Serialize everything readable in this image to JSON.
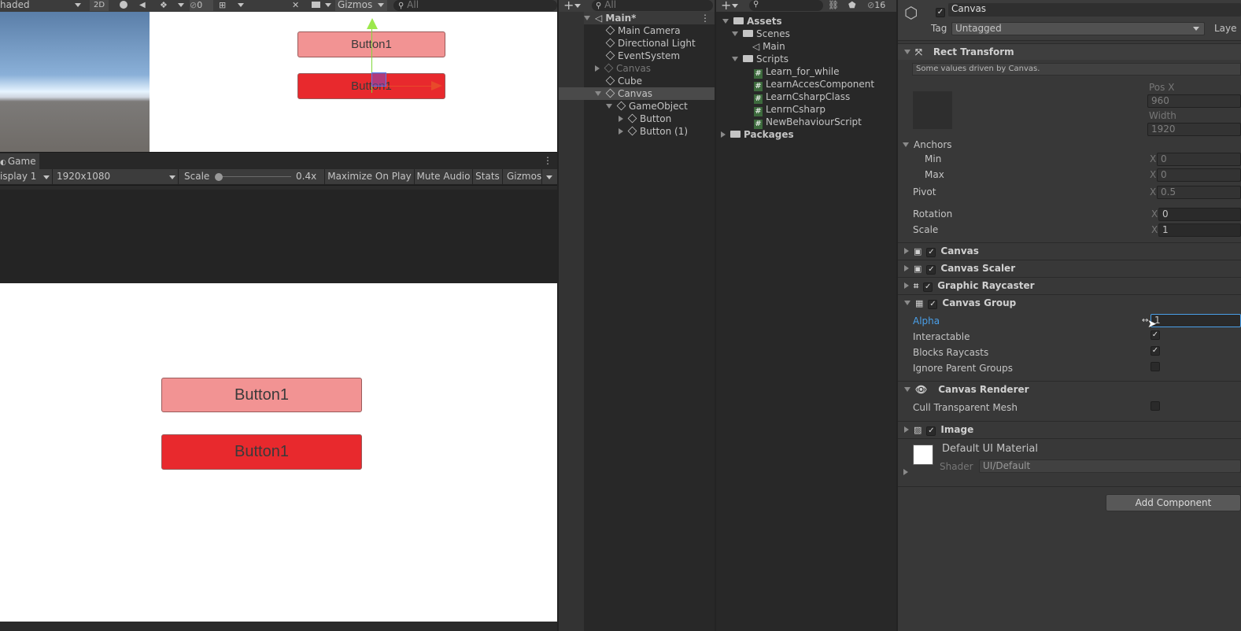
{
  "scene_toolbar": {
    "shading": "haded",
    "mode_2d": "2D",
    "hidden_count": "0",
    "gizmos": "Gizmos",
    "search_placeholder": "All"
  },
  "scene_view": {
    "button_top": "Button1",
    "button_bottom": "Button1"
  },
  "game_view": {
    "tab": "Game",
    "display": "isplay 1",
    "resolution": "1920x1080",
    "scale_label": "Scale",
    "scale_value": "0.4x",
    "maximize": "Maximize On Play",
    "mute": "Mute Audio",
    "stats": "Stats",
    "gizmos": "Gizmos",
    "button_top": "Button1",
    "button_bottom": "Button1",
    "scale_fraction": 0.0
  },
  "hierarchy": {
    "search_placeholder": "All",
    "scene": "Main*",
    "items": [
      {
        "label": "Main Camera"
      },
      {
        "label": "Directional Light"
      },
      {
        "label": "EventSystem"
      },
      {
        "label": "Canvas"
      },
      {
        "label": "Cube"
      },
      {
        "label": "Canvas"
      },
      {
        "label": "GameObject"
      },
      {
        "label": "Button"
      },
      {
        "label": "Button (1)"
      }
    ]
  },
  "project": {
    "hidden_count": "16",
    "items": [
      {
        "label": "Assets"
      },
      {
        "label": "Scenes"
      },
      {
        "label": "Main"
      },
      {
        "label": "Scripts"
      },
      {
        "label": "Learn_for_while"
      },
      {
        "label": "LearnAccesComponent"
      },
      {
        "label": "LearnCsharpClass"
      },
      {
        "label": "LenrnCsharp"
      },
      {
        "label": "NewBehaviourScript"
      },
      {
        "label": "Packages"
      }
    ]
  },
  "inspector": {
    "object_name": "Canvas",
    "tag_label": "Tag",
    "tag_value": "Untagged",
    "layer_label": "Laye",
    "rect_transform": {
      "title": "Rect Transform",
      "note": "Some values driven by Canvas.",
      "pos_x_label": "Pos X",
      "pos_x": "960",
      "width_label": "Width",
      "width": "1920",
      "anchors": "Anchors",
      "min": "Min",
      "max": "Max",
      "min_x": "0",
      "max_x": "0",
      "pivot": "Pivot",
      "pivot_x": "0.5",
      "rotation": "Rotation",
      "rotation_x": "0",
      "scale": "Scale",
      "scale_x": "1",
      "x": "X"
    },
    "components": {
      "canvas": "Canvas",
      "canvas_scaler": "Canvas Scaler",
      "graphic_raycaster": "Graphic Raycaster",
      "canvas_group": "Canvas Group",
      "canvas_renderer": "Canvas Renderer",
      "image": "Image"
    },
    "canvas_group": {
      "alpha": "Alpha",
      "alpha_value": "1",
      "interactable": "Interactable",
      "blocks_raycasts": "Blocks Raycasts",
      "ignore_parent": "Ignore Parent Groups",
      "interactable_checked": true,
      "blocks_checked": true,
      "ignore_checked": false
    },
    "canvas_renderer": {
      "cull": "Cull Transparent Mesh"
    },
    "material": {
      "name": "Default UI Material",
      "shader_label": "Shader",
      "shader_value": "UI/Default"
    },
    "add_component": "Add Component"
  },
  "colors": {
    "button_light": "#f29393",
    "button_dark": "#e8292d",
    "scene_bg": "#ffffff",
    "accent_blue": "#4a9fe8"
  }
}
